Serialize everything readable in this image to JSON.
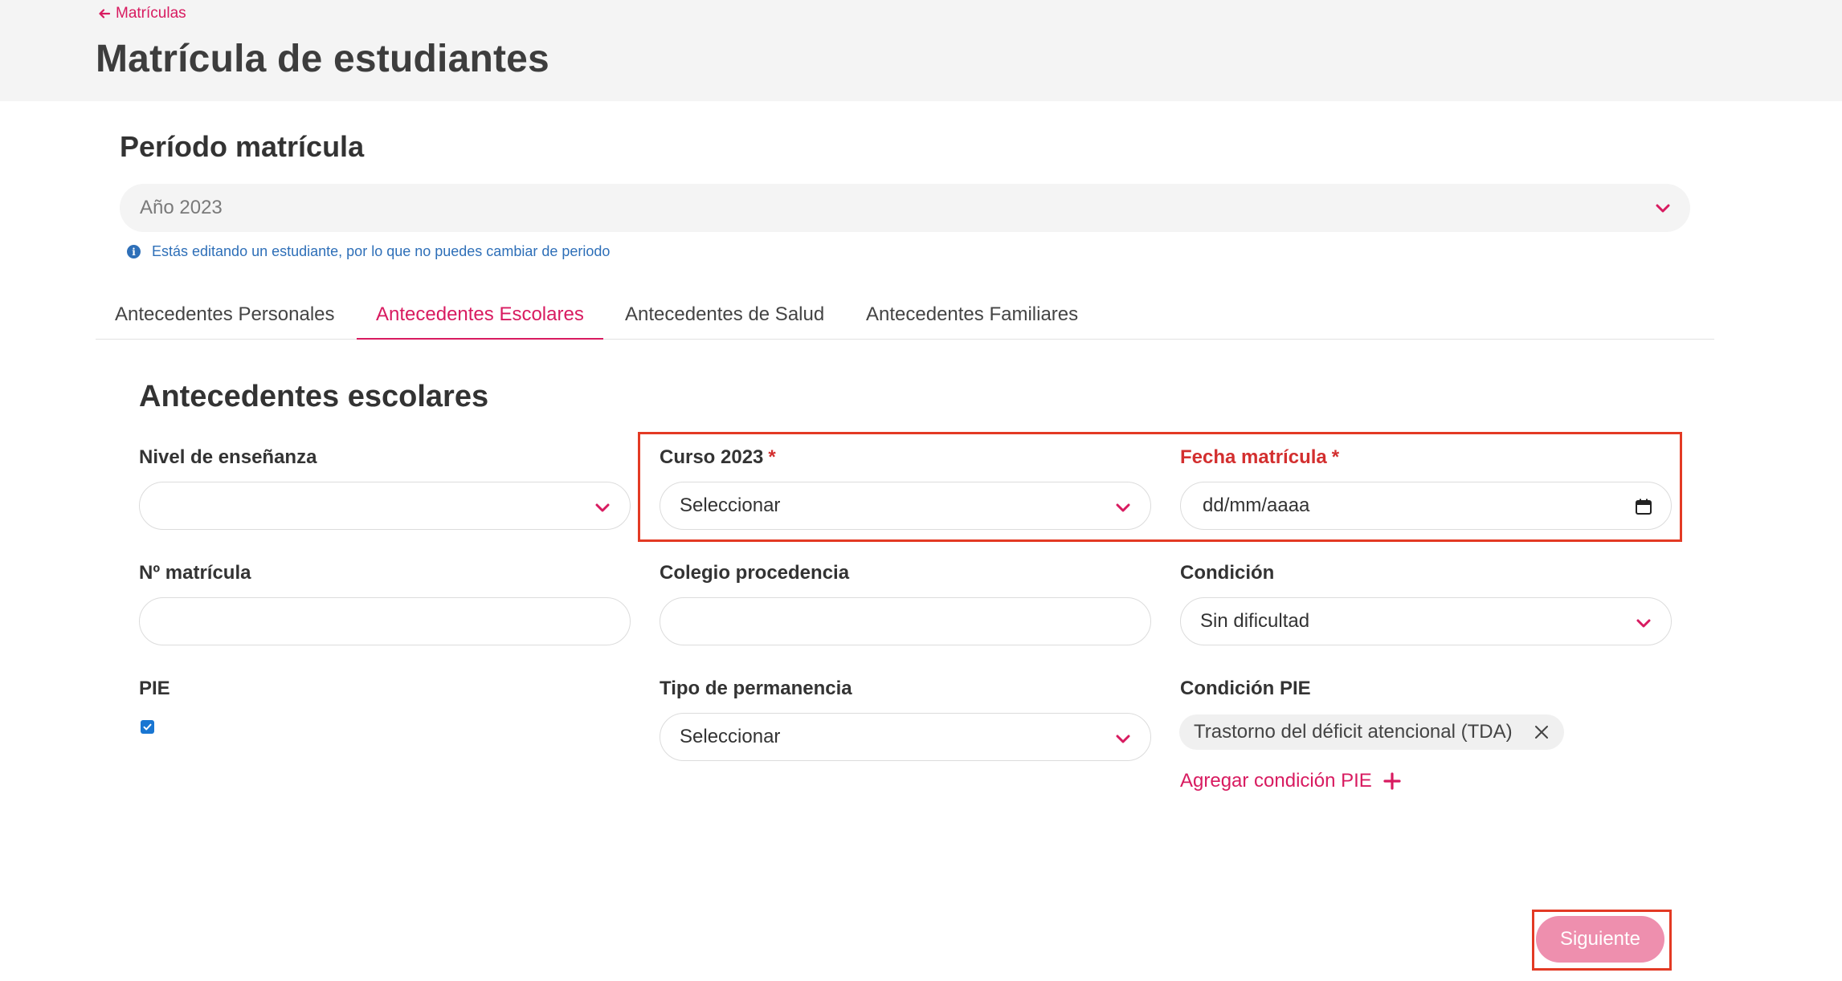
{
  "header": {
    "back_label": "Matrículas",
    "title": "Matrícula de estudiantes"
  },
  "periodo": {
    "title": "Período matrícula",
    "selected": "Año 2023",
    "info": "Estás editando un estudiante, por lo que no puedes cambiar de periodo"
  },
  "tabs": [
    {
      "label": "Antecedentes Personales"
    },
    {
      "label": "Antecedentes Escolares"
    },
    {
      "label": "Antecedentes de Salud"
    },
    {
      "label": "Antecedentes Familiares"
    }
  ],
  "form": {
    "section_title": "Antecedentes escolares",
    "nivel": {
      "label": "Nivel de enseñanza",
      "value": ""
    },
    "curso": {
      "label": "Curso 2023",
      "required": "*",
      "value": "Seleccionar"
    },
    "fecha": {
      "label": "Fecha matrícula",
      "required": "*",
      "placeholder": "dd/mm/aaaa"
    },
    "numero": {
      "label": "Nº matrícula",
      "value": ""
    },
    "colegio": {
      "label": "Colegio procedencia",
      "value": ""
    },
    "condicion": {
      "label": "Condición",
      "value": "Sin dificultad"
    },
    "pie": {
      "label": "PIE",
      "checked": true
    },
    "permanencia": {
      "label": "Tipo de permanencia",
      "value": "Seleccionar"
    },
    "condicion_pie": {
      "label": "Condición PIE",
      "chips": [
        {
          "label": "Trastorno del déficit atencional (TDA)"
        }
      ],
      "add_label": "Agregar condición PIE"
    }
  },
  "actions": {
    "next_label": "Siguiente"
  },
  "colors": {
    "accent": "#d81b60",
    "info": "#2e6fb8",
    "error": "#d32f2f",
    "highlight": "#e33a24",
    "button_disabled": "#ee8fae"
  },
  "icons": [
    "arrow-left-icon",
    "chevron-down-icon",
    "info-icon",
    "calendar-icon",
    "check-icon",
    "close-icon",
    "plus-icon"
  ]
}
